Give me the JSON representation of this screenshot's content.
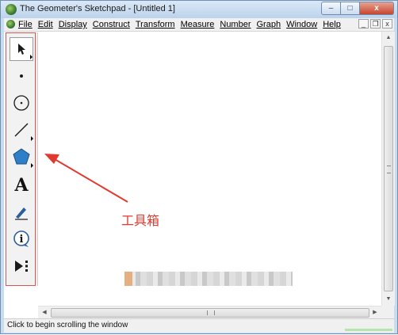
{
  "window": {
    "title": "The Geometer's Sketchpad - [Untitled 1]",
    "controls": {
      "minimize": "–",
      "maximize": "□",
      "close": "x"
    }
  },
  "menubar": {
    "items": [
      "File",
      "Edit",
      "Display",
      "Construct",
      "Transform",
      "Measure",
      "Number",
      "Graph",
      "Window",
      "Help"
    ],
    "mdi_controls": {
      "minimize": "_",
      "restore": "❐",
      "close": "x"
    }
  },
  "toolbox": {
    "tools": [
      {
        "name": "selection-arrow-tool",
        "icon": "arrow-icon",
        "selected": true
      },
      {
        "name": "point-tool",
        "icon": "point-icon",
        "selected": false
      },
      {
        "name": "compass-tool",
        "icon": "circle-icon",
        "selected": false
      },
      {
        "name": "straightedge-tool",
        "icon": "segment-icon",
        "selected": false
      },
      {
        "name": "polygon-tool",
        "icon": "pentagon-icon",
        "selected": false
      },
      {
        "name": "text-tool",
        "icon": "text-a-icon",
        "label": "A",
        "selected": false
      },
      {
        "name": "marker-tool",
        "icon": "marker-icon",
        "selected": false
      },
      {
        "name": "information-tool",
        "icon": "info-icon",
        "label": "i",
        "selected": false
      },
      {
        "name": "custom-tool",
        "icon": "play-dots-icon",
        "selected": false
      }
    ]
  },
  "annotation": {
    "label": "工具箱",
    "color": "#e03a2f"
  },
  "statusbar": {
    "text": "Click to begin scrolling the window"
  },
  "colors": {
    "accent": "#d9534f",
    "polygon_fill": "#2e7fc7",
    "titlebar": "#c9dcef"
  }
}
